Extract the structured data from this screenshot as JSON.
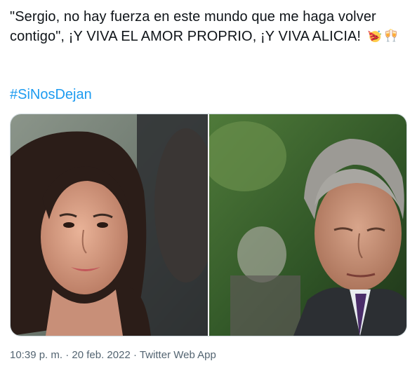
{
  "tweet": {
    "text": "\"Sergio, no hay fuerza en este mundo que me haga volver contigo\", ¡Y VIVA EL AMOR PROPRIO, ¡Y VIVA ALICIA!",
    "emojis": [
      "party-face-emoji",
      "clinking-glasses-emoji"
    ],
    "hashtag": "#SiNosDejan",
    "time": "10:39 p. m.",
    "separator": "·",
    "date": "20 feb. 2022",
    "source": "Twitter Web App"
  },
  "colors": {
    "text": "#0f1419",
    "link": "#1d9bf0",
    "meta": "#536471",
    "border": "#cfd9de"
  },
  "media": {
    "count": 2,
    "photos": [
      "woman-closeup-photo",
      "man-in-suit-photo"
    ]
  }
}
